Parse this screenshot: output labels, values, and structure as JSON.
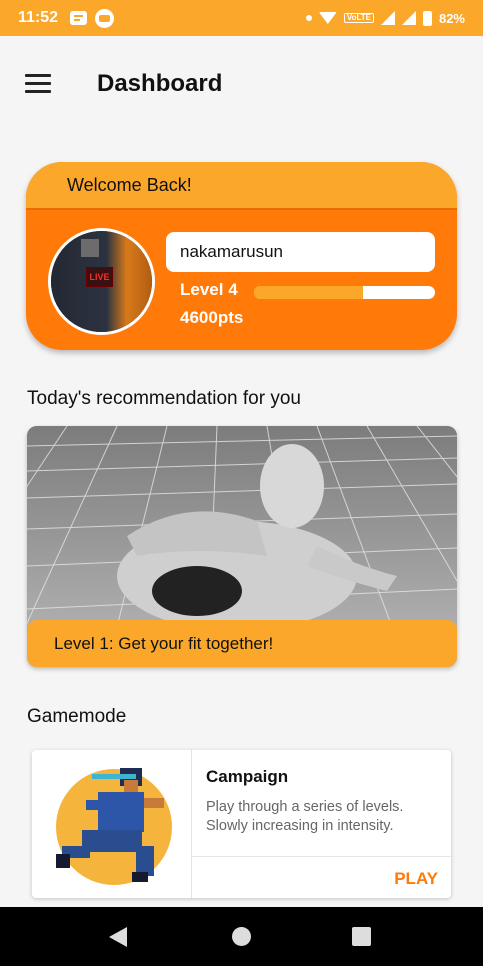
{
  "status_bar": {
    "time": "11:52",
    "battery": "82%",
    "network_badge": "VoLTE"
  },
  "app_bar": {
    "title": "Dashboard"
  },
  "welcome": {
    "heading": "Welcome Back!",
    "username": "nakamarusun",
    "level": "Level 4",
    "progress_fraction": 0.6,
    "points": "4600pts",
    "avatar_sign": "LIVE"
  },
  "recommendation": {
    "section_title": "Today's recommendation for you",
    "label": "Level 1: Get your fit together!"
  },
  "gamemode": {
    "section_title": "Gamemode",
    "cards": [
      {
        "name": "Campaign",
        "description": "Play through a series of levels. Slowly increasing in intensity.",
        "action": "PLAY"
      }
    ]
  },
  "colors": {
    "primary": "#FF7A09",
    "accent": "#FBA72A",
    "background": "#f5f5f5"
  }
}
